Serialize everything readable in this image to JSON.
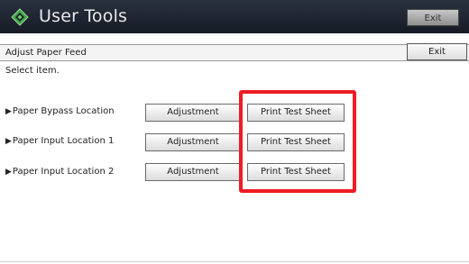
{
  "header": {
    "app_title": "User Tools",
    "exit_label": "Exit",
    "icon": "diamond-logo-icon"
  },
  "subheader": {
    "title": "Adjust Paper Feed",
    "exit_label": "Exit"
  },
  "instruction": "Select item.",
  "rows": [
    {
      "label": "Paper Bypass Location",
      "adjust_label": "Adjustment",
      "print_label": "Print Test Sheet"
    },
    {
      "label": "Paper Input Location 1",
      "adjust_label": "Adjustment",
      "print_label": "Print Test Sheet"
    },
    {
      "label": "Paper Input Location 2",
      "adjust_label": "Adjustment",
      "print_label": "Print Test Sheet"
    }
  ],
  "colors": {
    "titlebar": "#1d232d",
    "highlight": "#ee1c24"
  }
}
